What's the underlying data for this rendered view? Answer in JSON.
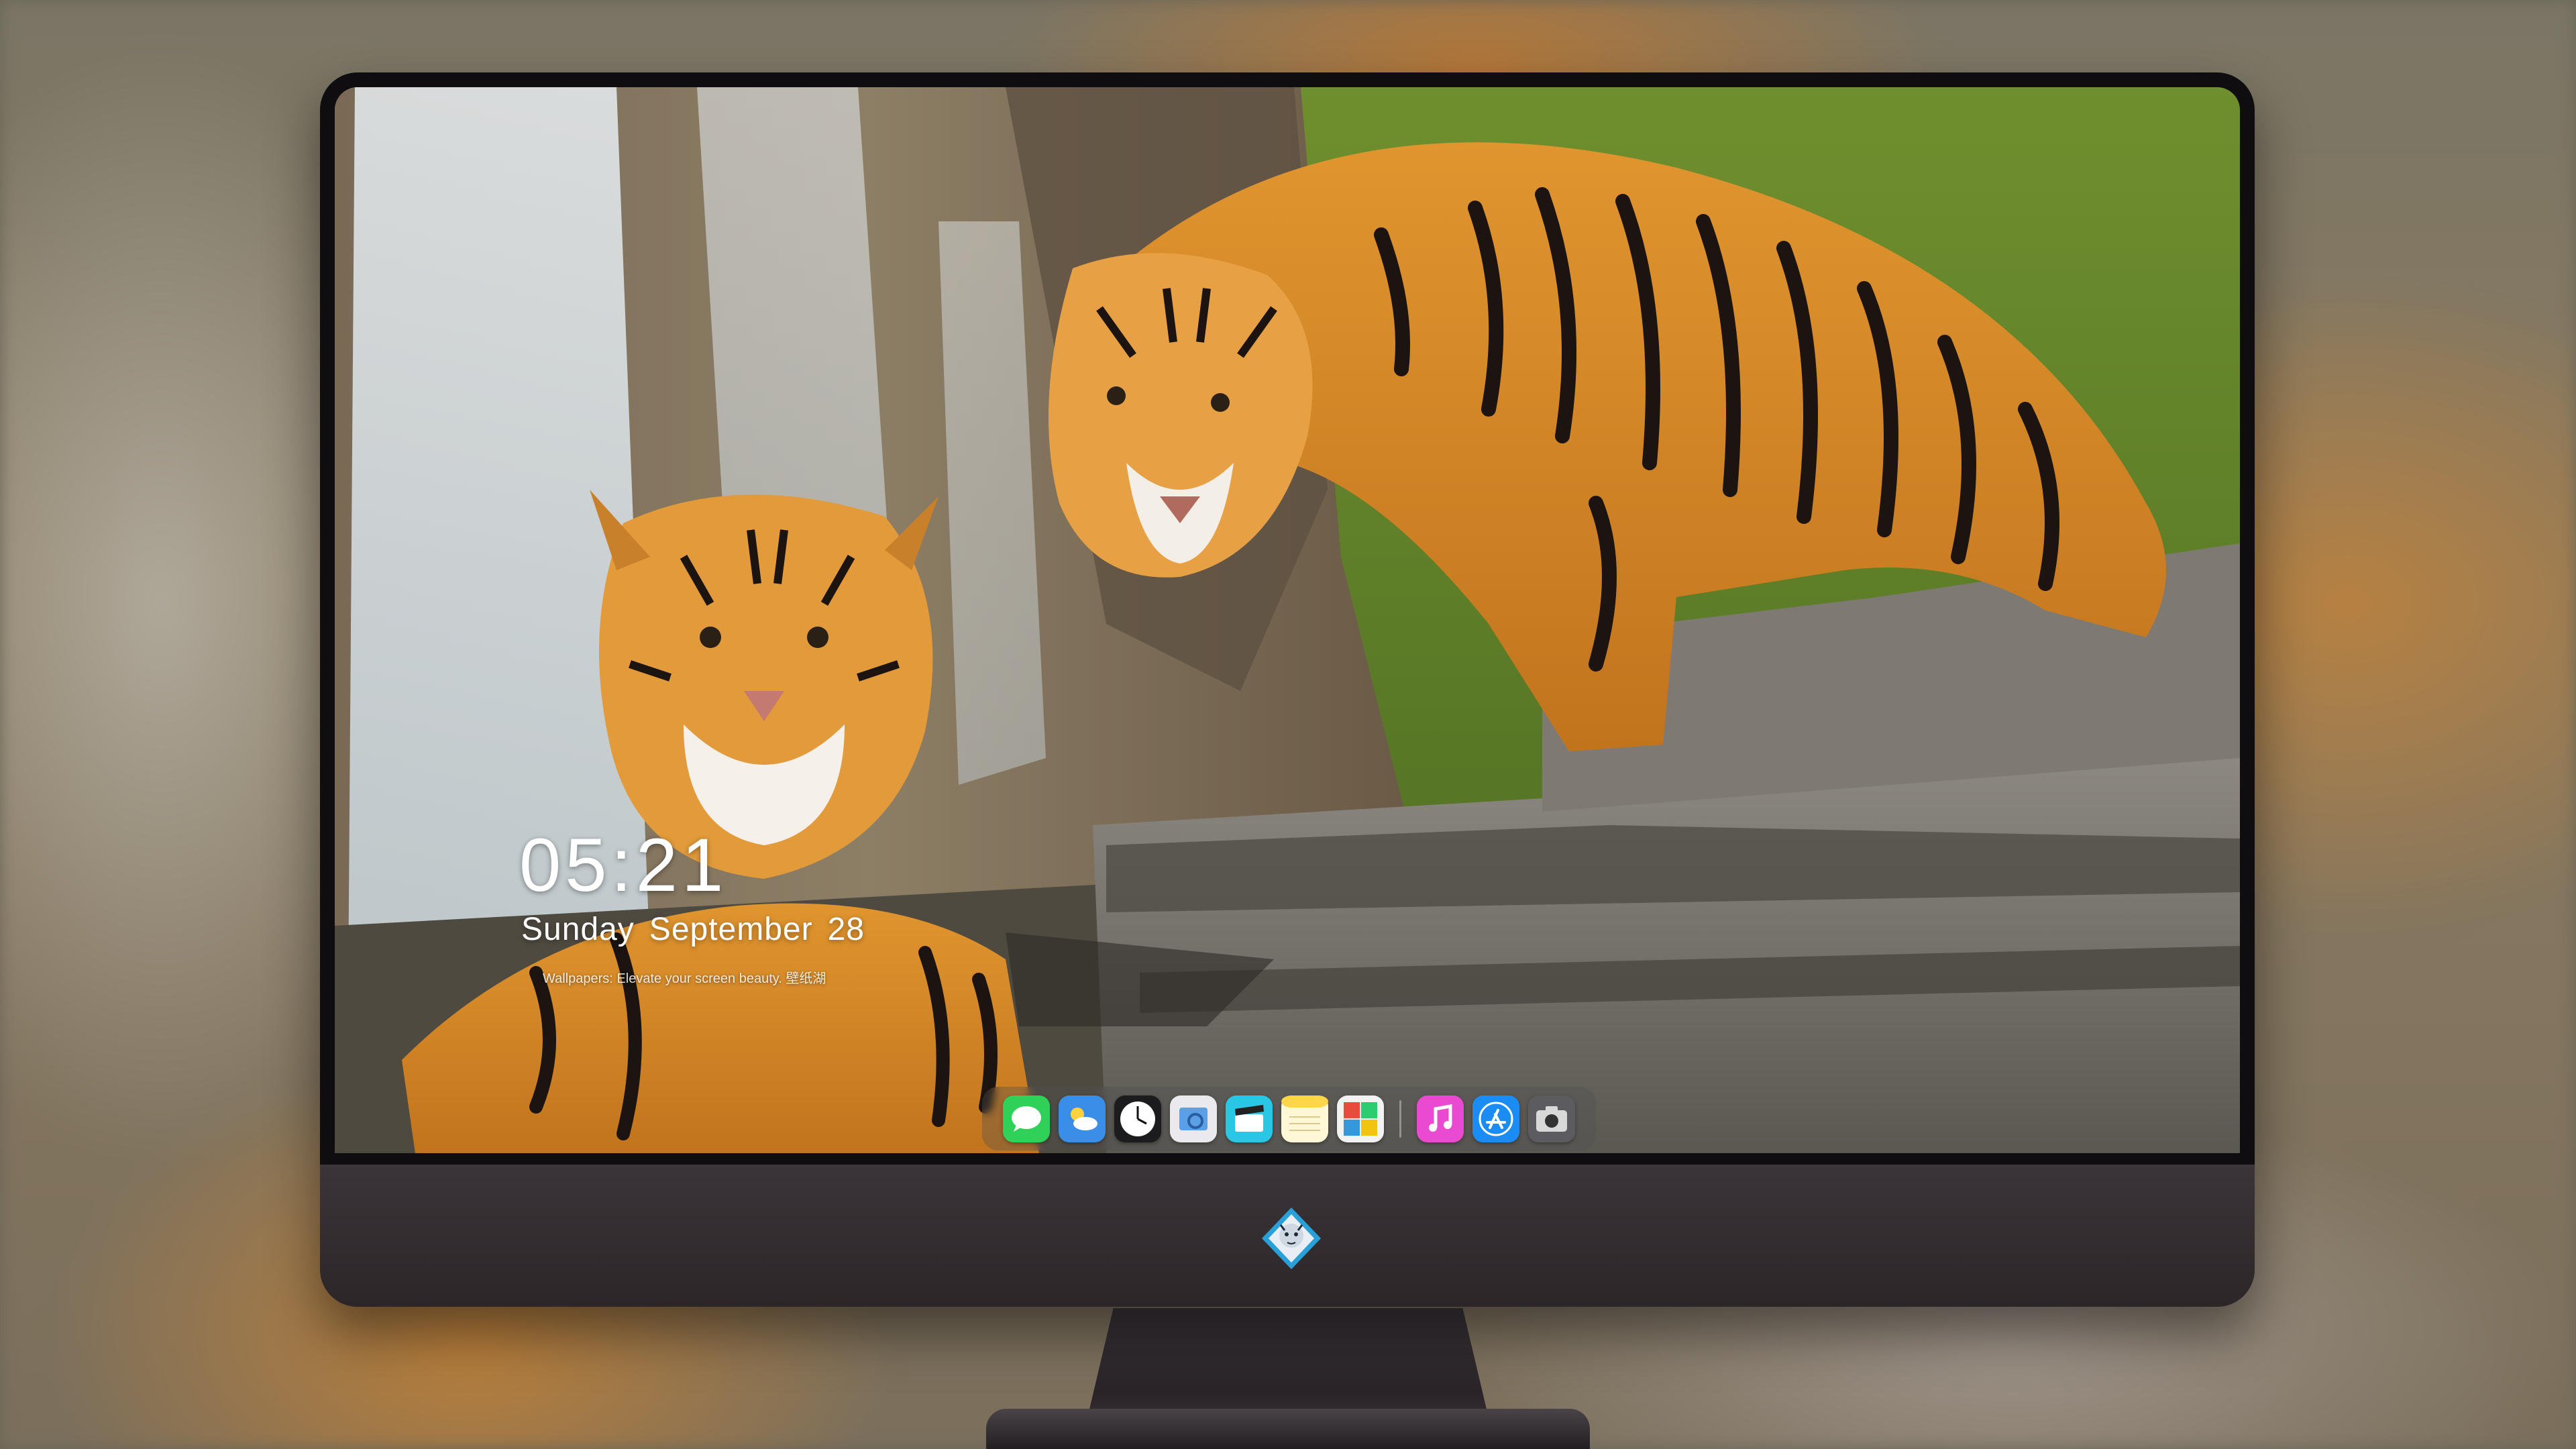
{
  "lockscreen": {
    "time": "05:21",
    "weekday": "Sunday",
    "month": "September",
    "day": "28",
    "tagline": "Wallpapers: Elevate your screen beauty. 壁纸湖"
  },
  "dock": {
    "apps": [
      {
        "icon": "messages-icon"
      },
      {
        "icon": "weather-icon"
      },
      {
        "icon": "clock-icon"
      },
      {
        "icon": "preview-icon"
      },
      {
        "icon": "clips-icon"
      },
      {
        "icon": "notes-icon"
      },
      {
        "icon": "photo-booth-icon"
      },
      {
        "icon": "music-icon"
      },
      {
        "icon": "app-store-icon"
      },
      {
        "icon": "camera-icon"
      }
    ]
  },
  "monitor": {
    "brand_logo": "tiger-mascot-logo-icon"
  },
  "colors": {
    "monitor_frame": "#0f0d10",
    "chin": "#3b3438",
    "tiger_orange": "#d98a2e",
    "rock": "#7d7a74",
    "foliage": "#5a7a2a"
  }
}
